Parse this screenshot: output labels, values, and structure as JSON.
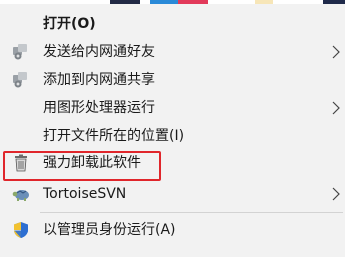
{
  "context_menu": {
    "items": [
      {
        "label": "打开(O)",
        "icon": null,
        "submenu": false
      },
      {
        "label": "发送给内网通好友",
        "icon": "share-network-icon",
        "submenu": true
      },
      {
        "label": "添加到内网通共享",
        "icon": "share-network-icon",
        "submenu": false
      },
      {
        "label": "用图形处理器运行",
        "icon": null,
        "submenu": true
      },
      {
        "label": "打开文件所在的位置(I)",
        "icon": null,
        "submenu": false
      },
      {
        "label": "强力卸载此软件",
        "icon": "trash-bin-icon",
        "submenu": false
      },
      {
        "label": "TortoiseSVN",
        "icon": "tortoise-svn-icon",
        "submenu": true
      },
      {
        "label": "以管理员身份运行(A)",
        "icon": "uac-shield-icon",
        "submenu": false
      }
    ]
  },
  "colors": {
    "menu_background": "#f2f2f2",
    "highlight_border": "#e0262b",
    "separator": "#d3d3d3",
    "text": "#1a1a1a"
  }
}
